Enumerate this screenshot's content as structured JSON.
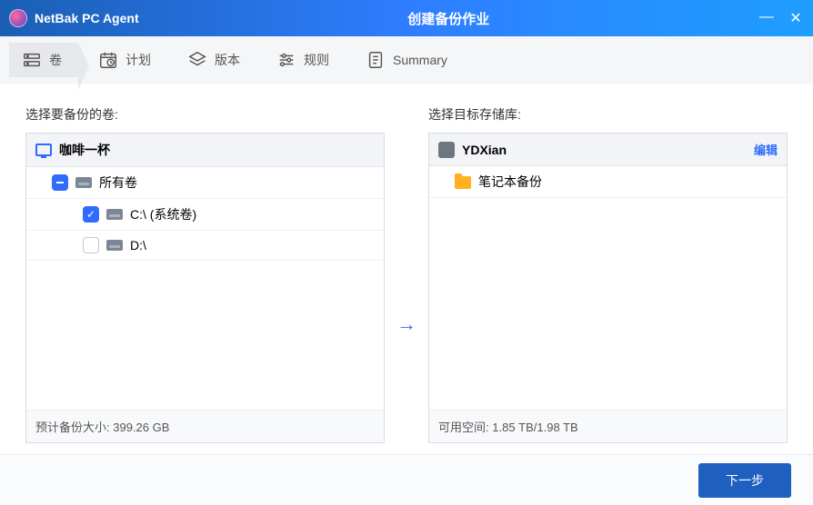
{
  "titlebar": {
    "app_name": "NetBak PC Agent",
    "window_title": "创建备份作业"
  },
  "steps": {
    "volume": "卷",
    "schedule": "计划",
    "version": "版本",
    "rule": "规则",
    "summary": "Summary"
  },
  "source": {
    "title": "选择要备份的卷:",
    "host": "咖啡一杯",
    "all_volumes": "所有卷",
    "vol_c": "C:\\ (系统卷)",
    "vol_d": "D:\\",
    "estimate_label": "预计备份大小:",
    "estimate_value": "399.26 GB"
  },
  "target": {
    "title": "选择目标存储库:",
    "repo": "YDXian",
    "edit": "编辑",
    "folder": "笔记本备份",
    "space_label": "可用空间:",
    "space_value": "1.85 TB/1.98 TB"
  },
  "footer": {
    "next": "下一步"
  }
}
